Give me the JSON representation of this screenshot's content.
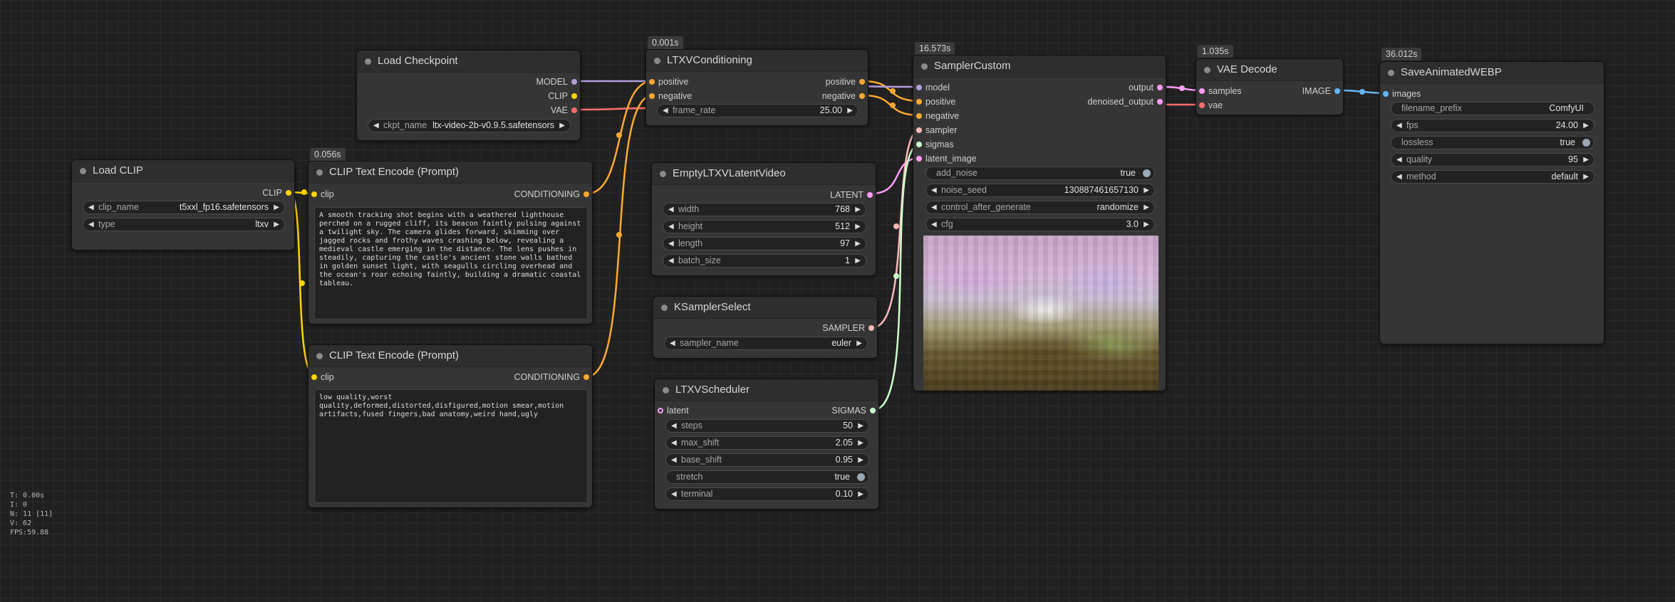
{
  "colors": {
    "model": "#b39ddb",
    "clip": "#ffd500",
    "vae": "#ff6e6e",
    "conditioning": "#ffa931",
    "latent": "#ff9cf9",
    "sampler": "#ffb8b8",
    "sigmas": "#cdffcd",
    "image": "#64b5f6"
  },
  "stats": {
    "t": "T: 0.00s",
    "i": "I: 0",
    "n": "N: 11 [11]",
    "v": "V: 62",
    "fps": "FPS:59.88"
  },
  "nodes": {
    "load_checkpoint": {
      "title": "Load Checkpoint",
      "outputs": [
        "MODEL",
        "CLIP",
        "VAE"
      ],
      "ckpt_label": "ckpt_name",
      "ckpt_value": "ltx-video-2b-v0.9.5.safetensors"
    },
    "load_clip": {
      "title": "Load CLIP",
      "output": "CLIP",
      "clip_name_label": "clip_name",
      "clip_name_value": "t5xxl_fp16.safetensors",
      "type_label": "type",
      "type_value": "ltxv"
    },
    "clip_pos": {
      "time": "0.056s",
      "title": "CLIP Text Encode (Prompt)",
      "input": "clip",
      "output": "CONDITIONING",
      "text": "A smooth tracking shot begins with a weathered lighthouse perched on a rugged cliff, its beacon faintly pulsing against a twilight sky. The camera glides forward, skimming over jagged rocks and frothy waves crashing below, revealing a medieval castle emerging in the distance. The lens pushes in steadily, capturing the castle's ancient stone walls bathed in golden sunset light, with seagulls circling overhead and the ocean's roar echoing faintly, building a dramatic coastal tableau."
    },
    "clip_neg": {
      "title": "CLIP Text Encode (Prompt)",
      "input": "clip",
      "output": "CONDITIONING",
      "text": "low quality,worst quality,deformed,distorted,disfigured,motion smear,motion artifacts,fused fingers,bad anatomy,weird hand,ugly"
    },
    "ltxv_cond": {
      "time": "0.001s",
      "title": "LTXVConditioning",
      "in_positive": "positive",
      "in_negative": "negative",
      "out_positive": "positive",
      "out_negative": "negative",
      "frame_rate_label": "frame_rate",
      "frame_rate_value": "25.00"
    },
    "empty_latent": {
      "title": "EmptyLTXVLatentVideo",
      "output": "LATENT",
      "width_label": "width",
      "width_value": "768",
      "height_label": "height",
      "height_value": "512",
      "length_label": "length",
      "length_value": "97",
      "batch_label": "batch_size",
      "batch_value": "1"
    },
    "ksampler_select": {
      "title": "KSamplerSelect",
      "output": "SAMPLER",
      "sampler_label": "sampler_name",
      "sampler_value": "euler"
    },
    "scheduler": {
      "title": "LTXVScheduler",
      "input": "latent",
      "output": "SIGMAS",
      "steps_label": "steps",
      "steps_value": "50",
      "max_shift_label": "max_shift",
      "max_shift_value": "2.05",
      "base_shift_label": "base_shift",
      "base_shift_value": "0.95",
      "stretch_label": "stretch",
      "stretch_value": "true",
      "terminal_label": "terminal",
      "terminal_value": "0.10"
    },
    "sampler_custom": {
      "time": "16.573s",
      "title": "SamplerCustom",
      "inputs": [
        "model",
        "positive",
        "negative",
        "sampler",
        "sigmas",
        "latent_image"
      ],
      "out_output": "output",
      "out_denoised": "denoised_output",
      "add_noise_label": "add_noise",
      "add_noise_value": "true",
      "noise_seed_label": "noise_seed",
      "noise_seed_value": "130887461657130",
      "control_label": "control_after_generate",
      "control_value": "randomize",
      "cfg_label": "cfg",
      "cfg_value": "3.0"
    },
    "vae_decode": {
      "time": "1.035s",
      "title": "VAE Decode",
      "in_samples": "samples",
      "in_vae": "vae",
      "output": "IMAGE"
    },
    "save_webp": {
      "time": "36.012s",
      "title": "SaveAnimatedWEBP",
      "input": "images",
      "filename_label": "filename_prefix",
      "filename_value": "ComfyUI",
      "fps_label": "fps",
      "fps_value": "24.00",
      "lossless_label": "lossless",
      "lossless_value": "true",
      "quality_label": "quality",
      "quality_value": "95",
      "method_label": "method",
      "method_value": "default"
    }
  }
}
